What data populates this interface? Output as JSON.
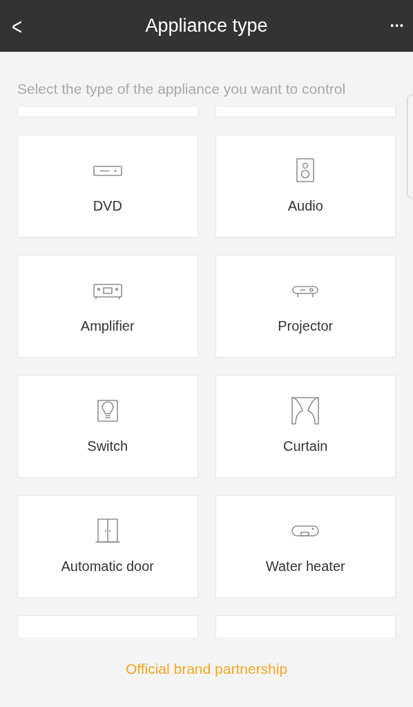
{
  "header": {
    "back": "<",
    "title": "Appliance type",
    "more": "•••"
  },
  "subtitle": "Select the type of the appliance you want to control",
  "appliances": [
    {
      "label": "DVD",
      "kind": "dvd"
    },
    {
      "label": "Audio",
      "kind": "speaker"
    },
    {
      "label": "Amplifier",
      "kind": "amplifier"
    },
    {
      "label": "Projector",
      "kind": "projector"
    },
    {
      "label": "Switch",
      "kind": "switch"
    },
    {
      "label": "Curtain",
      "kind": "curtain"
    },
    {
      "label": "Automatic door",
      "kind": "door"
    },
    {
      "label": "Water heater",
      "kind": "water_heater"
    }
  ],
  "footer_link": "Official brand partnership"
}
